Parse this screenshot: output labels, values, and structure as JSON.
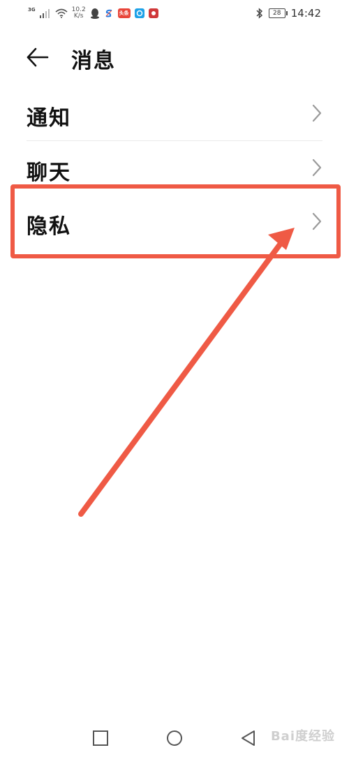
{
  "status_bar": {
    "network": "3G",
    "speed_value": "10.2",
    "speed_unit": "K/s",
    "app_badge_text": "头条",
    "battery": "28",
    "time": "14:42"
  },
  "header": {
    "title": "消息"
  },
  "menu": {
    "items": [
      {
        "label": "通知"
      },
      {
        "label": "聊天"
      },
      {
        "label": "隐私"
      }
    ]
  },
  "watermark": {
    "text": "Bai度经验"
  },
  "colors": {
    "annotation": "#ef5a45",
    "text": "#111111",
    "chevron": "#9a9a9a",
    "divider": "#e9e9e9"
  }
}
